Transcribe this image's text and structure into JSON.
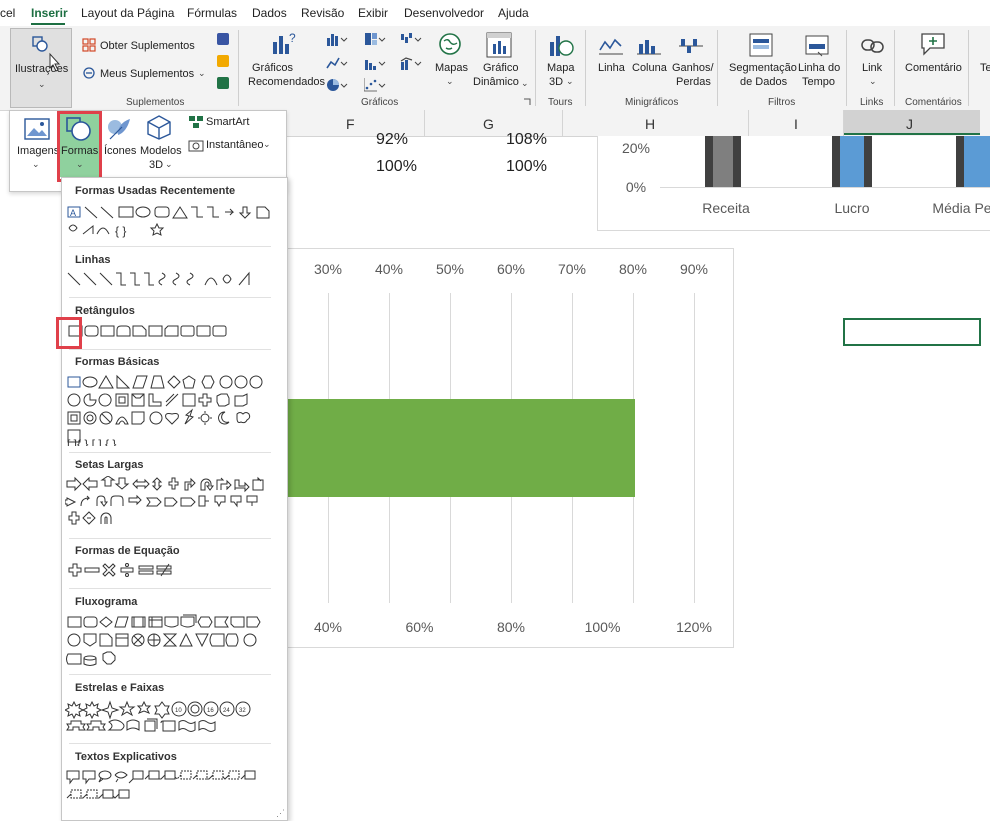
{
  "menu": {
    "items": [
      "cel",
      "Inserir",
      "Layout da Página",
      "Fórmulas",
      "Dados",
      "Revisão",
      "Exibir",
      "Desenvolvedor",
      "Ajuda"
    ]
  },
  "ribbon": {
    "ilustracoes": "Ilustrações",
    "obter_suplementos": "Obter Suplementos",
    "meus_suplementos": "Meus Suplementos",
    "group_suplementos": "Suplementos",
    "graficos_recomendados_1": "Gráficos",
    "graficos_recomendados_2": "Recomendados",
    "mapas": "Mapas",
    "grafico_dinamico_1": "Gráfico",
    "grafico_dinamico_2": "Dinâmico",
    "group_graficos": "Gráficos",
    "mapa3d_1": "Mapa",
    "mapa3d_2": "3D",
    "group_tours": "Tours",
    "linha": "Linha",
    "coluna": "Coluna",
    "ganhos_1": "Ganhos/",
    "ganhos_2": "Perdas",
    "group_minigraficos": "Minigráficos",
    "segmentacao_1": "Segmentação",
    "segmentacao_2": "de Dados",
    "linha_tempo_1": "Linha do",
    "linha_tempo_2": "Tempo",
    "group_filtros": "Filtros",
    "link": "Link",
    "group_links": "Links",
    "comentario": "Comentário",
    "group_comentarios": "Comentários",
    "te": "Te"
  },
  "illustrations_panel": {
    "imagens": "Imagens",
    "formas": "Formas",
    "icones": "Ícones",
    "modelos3d_1": "Modelos",
    "modelos3d_2": "3D",
    "smartart": "SmartArt",
    "instantaneo": "Instantâneo"
  },
  "columns": [
    "F",
    "G",
    "H",
    "I",
    "J"
  ],
  "cells": {
    "f_row1": "92%",
    "g_row1": "108%",
    "f_row2": "100%",
    "g_row2": "100%"
  },
  "shapes_sections": [
    "Formas Usadas Recentemente",
    "Linhas",
    "Retângulos",
    "Formas Básicas",
    "Setas Largas",
    "Formas de Equação",
    "Fluxograma",
    "Estrelas e Faixas",
    "Textos Explicativos"
  ],
  "chart_data": [
    {
      "type": "bar",
      "categories": [
        "Receita",
        "Lucro",
        "Média Pe"
      ],
      "y_tick_labels": [
        "20%",
        "0%"
      ],
      "colors": {
        "gray": "#7f7f7f",
        "blue": "#5b9bd5"
      }
    },
    {
      "type": "bar",
      "orientation": "horizontal",
      "top_axis_ticks": [
        "30%",
        "40%",
        "50%",
        "60%",
        "70%",
        "80%",
        "90%"
      ],
      "bottom_axis_ticks": [
        "40%",
        "60%",
        "80%",
        "100%",
        "120%"
      ],
      "bar_value": 1.07,
      "bar_color": "#70ad47"
    }
  ],
  "colors": {
    "accent": "#1d6f42",
    "highlight": "#e0404a",
    "selected_button": "#8fd19e"
  }
}
